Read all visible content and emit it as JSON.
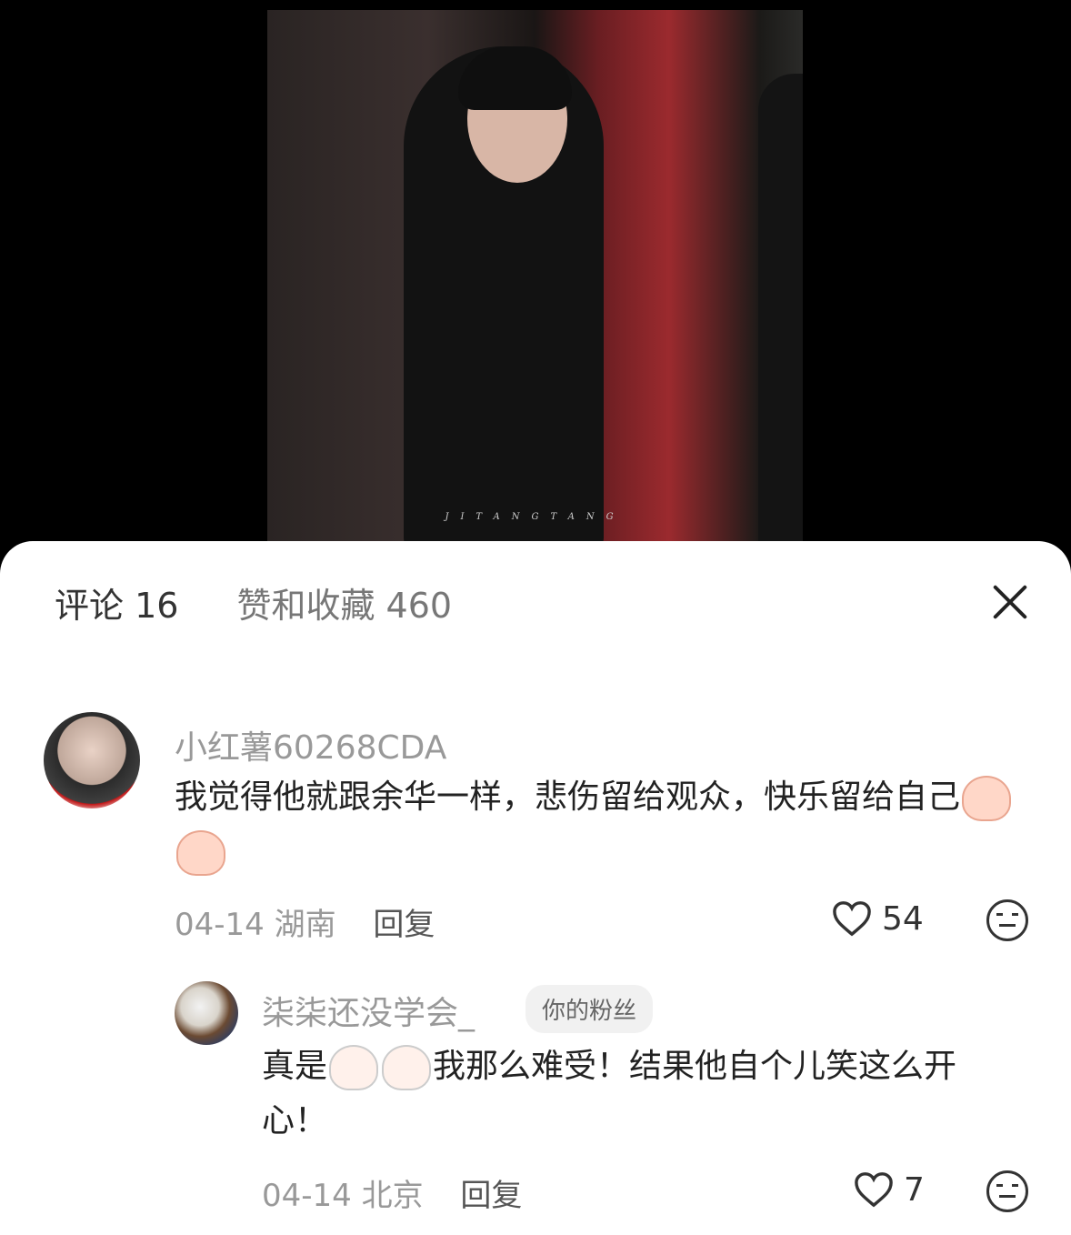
{
  "media": {
    "watermark": "JITANGTANG"
  },
  "tabs": [
    {
      "label": "评论 16"
    },
    {
      "label": "赞和收藏 460"
    }
  ],
  "comments": [
    {
      "author": "小红薯60268CDA",
      "text_before": "我觉得他就跟余华一样，悲伤留给观众，快乐留给自己",
      "emoji_names": [
        "crying-face-emoji",
        "crying-face-emoji"
      ],
      "date": "04-14",
      "location": "湖南",
      "reply_label": "回复",
      "likes": "54"
    },
    {
      "author": "柒柒还没学会_",
      "badge": "你的粉丝",
      "text_part1": "真是",
      "emoji_names": [
        "crying-cat-emoji",
        "crying-cat-emoji"
      ],
      "text_part2": "我那么难受！结果他自个儿笑这么开心！",
      "date": "04-14",
      "location": "北京",
      "reply_label": "回复",
      "likes": "7"
    }
  ]
}
